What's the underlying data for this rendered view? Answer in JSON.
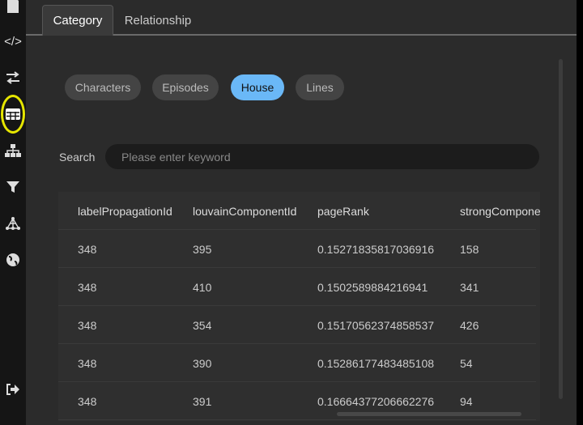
{
  "sidebar": {
    "icons": [
      "file-icon",
      "code-icon",
      "swap-icon",
      "table-icon",
      "hierarchy-icon",
      "filter-icon",
      "network-icon",
      "globe-icon",
      "logout-icon"
    ],
    "active": "table-icon",
    "highlight_color": "#e6e600"
  },
  "tabs": [
    {
      "label": "Category",
      "active": true
    },
    {
      "label": "Relationship",
      "active": false
    }
  ],
  "categories": [
    {
      "label": "Characters",
      "selected": false
    },
    {
      "label": "Episodes",
      "selected": false
    },
    {
      "label": "House",
      "selected": true
    },
    {
      "label": "Lines",
      "selected": false
    }
  ],
  "accent": "#6ab8f7",
  "search": {
    "label": "Search",
    "placeholder": "Please enter keyword",
    "value": ""
  },
  "table": {
    "columns": [
      "labelPropagationId",
      "louvainComponentId",
      "pageRank",
      "strongCompone"
    ],
    "rows": [
      [
        "348",
        "395",
        "0.15271835817036916",
        "158"
      ],
      [
        "348",
        "410",
        "0.1502589884216941",
        "341"
      ],
      [
        "348",
        "354",
        "0.15170562374858537",
        "426"
      ],
      [
        "348",
        "390",
        "0.15286177483485108",
        "54"
      ],
      [
        "348",
        "391",
        "0.16664377206662276",
        "94"
      ]
    ]
  }
}
